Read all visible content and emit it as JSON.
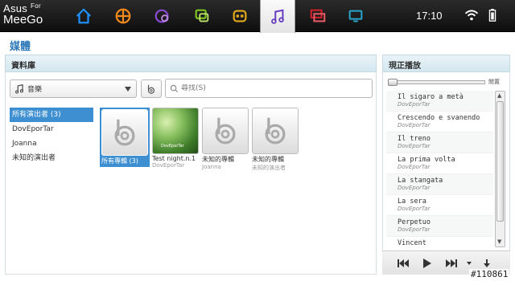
{
  "brand": {
    "line1": "Asus",
    "for": "For",
    "line2": "MeeGo"
  },
  "nav": {
    "tabs": [
      {
        "name": "home-tab",
        "icon": "home-icon",
        "color": "#1e90ff"
      },
      {
        "name": "apps-tab",
        "icon": "grid-circle-icon",
        "color": "#f08a1c"
      },
      {
        "name": "people-tab",
        "icon": "people-icon",
        "color": "#8a4bd6"
      },
      {
        "name": "chat-tab",
        "icon": "chat-icon",
        "color": "#7ec41c"
      },
      {
        "name": "games-tab",
        "icon": "games-icon",
        "color": "#e0a81a"
      },
      {
        "name": "music-tab",
        "icon": "music-note-icon",
        "color": "#6b3fc4",
        "active": true
      },
      {
        "name": "windows-tab",
        "icon": "windows-icon",
        "color": "#d8202c"
      },
      {
        "name": "devices-tab",
        "icon": "devices-icon",
        "color": "#2aa4c8"
      }
    ]
  },
  "status": {
    "time": "17:10",
    "wifi_icon": "wifi-icon",
    "battery_icon": "battery-icon"
  },
  "page": {
    "title": "媒體"
  },
  "library": {
    "header": "資料庫",
    "category": "音樂",
    "search_placeholder": "尋找(S)",
    "artists": [
      {
        "label": "所有演出者 (3)",
        "selected": true
      },
      {
        "label": "DovEporTar",
        "selected": false
      },
      {
        "label": "Joanna",
        "selected": false
      },
      {
        "label": "未知的演出者",
        "selected": false
      }
    ],
    "albums": [
      {
        "title": "所有專輯 (3)",
        "artist": "",
        "selected": true
      },
      {
        "title": "Test night.n.1",
        "artist": "DovEporTar",
        "photo": true
      },
      {
        "title": "未知的專輯",
        "artist": "Joanna"
      },
      {
        "title": "未知的專輯",
        "artist": "未知的演出者"
      }
    ]
  },
  "now_playing": {
    "header": "現正播放",
    "volume_label": "閒置",
    "progress": 0.0,
    "tracks": [
      {
        "title": "Il sigaro a metà",
        "artist": "DovEporTar"
      },
      {
        "title": "Crescendo e svanendo",
        "artist": "DovEporTar"
      },
      {
        "title": "Il treno",
        "artist": "DovEporTar"
      },
      {
        "title": "La prima volta",
        "artist": "DovEporTar"
      },
      {
        "title": "La stangata",
        "artist": "DovEporTar"
      },
      {
        "title": "La sera",
        "artist": "DovEporTar"
      },
      {
        "title": "Perpetuo",
        "artist": "DovEporTar"
      },
      {
        "title": "Vincent",
        "artist": ""
      }
    ],
    "controls": [
      "previous-icon",
      "play-icon",
      "next-icon",
      "dropdown-arrow-icon",
      "download-icon"
    ]
  },
  "watermark": "#110861"
}
